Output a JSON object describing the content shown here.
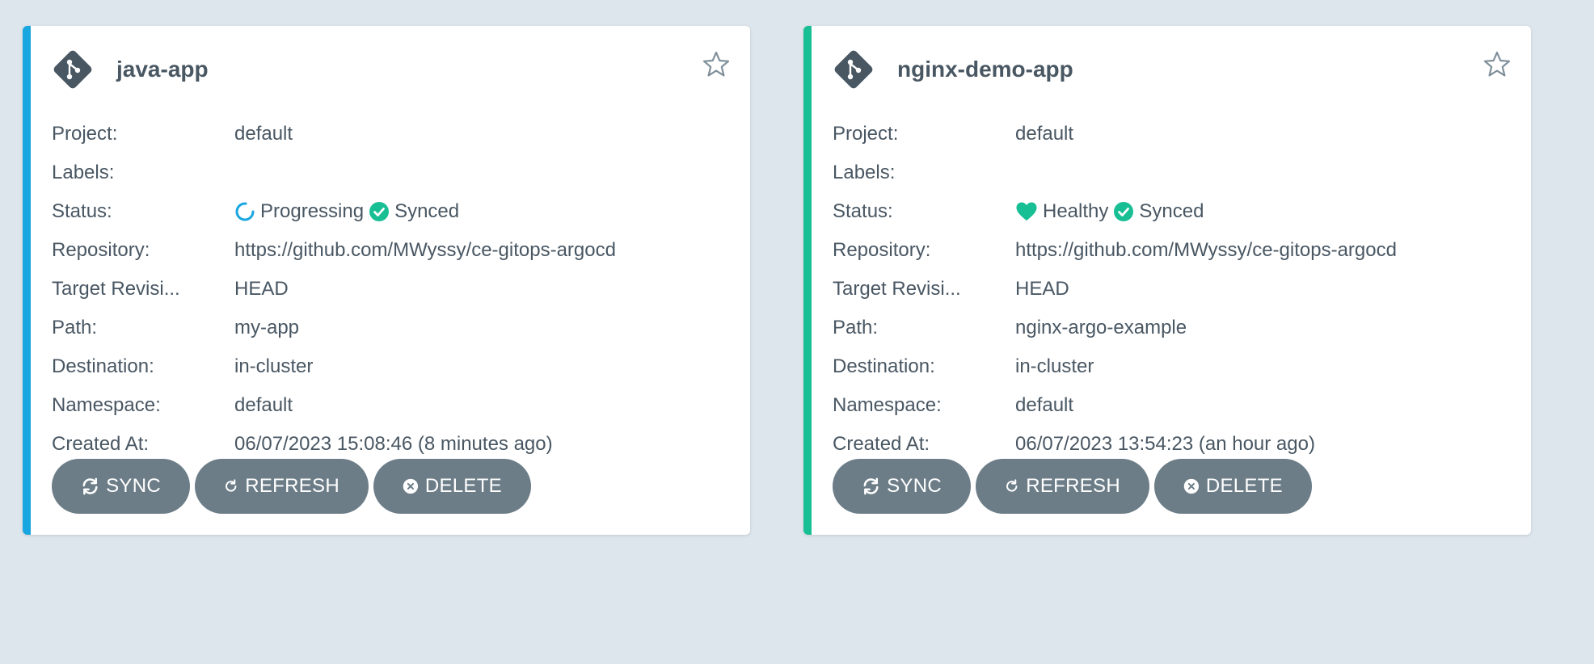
{
  "colors": {
    "background": "#dee6ed",
    "progressing_accent": "#18a6e0",
    "healthy_accent": "#18be94",
    "synced": "#18be94",
    "button": "#6c7d88",
    "text": "#495763"
  },
  "labels": {
    "project": "Project:",
    "labels": "Labels:",
    "status": "Status:",
    "repository": "Repository:",
    "target_revision": "Target Revisi...",
    "path": "Path:",
    "destination": "Destination:",
    "namespace": "Namespace:",
    "created_at": "Created At:"
  },
  "buttons": {
    "sync": "SYNC",
    "refresh": "REFRESH",
    "delete": "DELETE"
  },
  "apps": [
    {
      "name": "java-app",
      "project": "default",
      "labels": "",
      "health_status": "Progressing",
      "health_icon": "progressing-spinner-icon",
      "sync_status": "Synced",
      "repository": "https://github.com/MWyssy/ce-gitops-argocd",
      "target_revision": "HEAD",
      "path": "my-app",
      "destination": "in-cluster",
      "namespace": "default",
      "created_at": "06/07/2023 15:08:46  (8 minutes ago)"
    },
    {
      "name": "nginx-demo-app",
      "project": "default",
      "labels": "",
      "health_status": "Healthy",
      "health_icon": "heart-icon",
      "sync_status": "Synced",
      "repository": "https://github.com/MWyssy/ce-gitops-argocd",
      "target_revision": "HEAD",
      "path": "nginx-argo-example",
      "destination": "in-cluster",
      "namespace": "default",
      "created_at": "06/07/2023 13:54:23  (an hour ago)"
    }
  ]
}
